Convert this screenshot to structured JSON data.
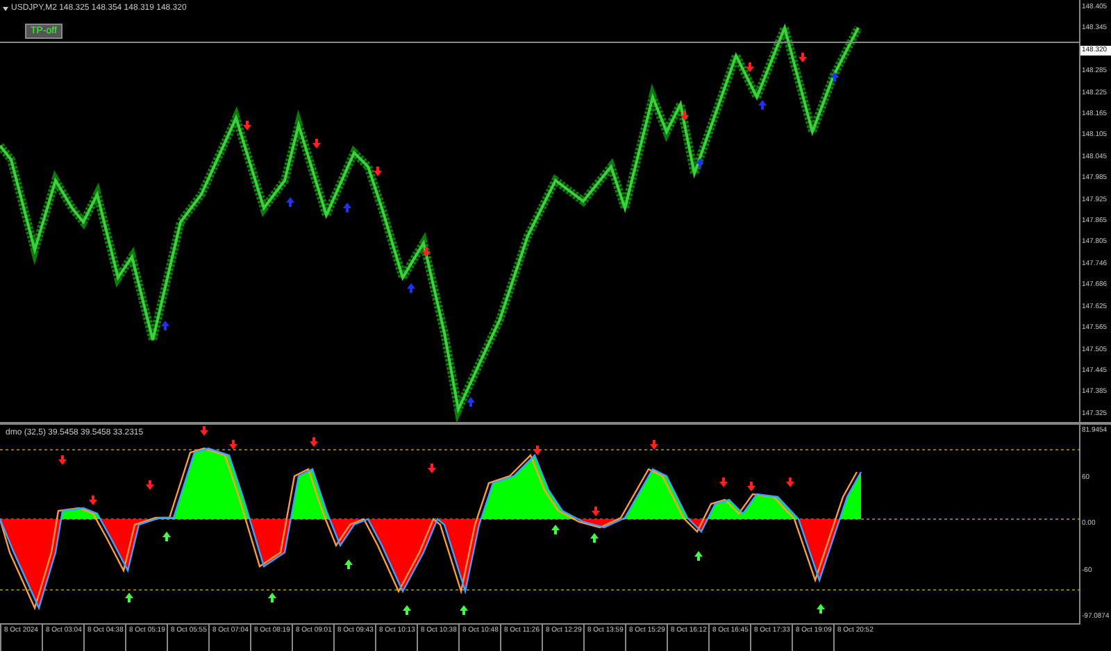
{
  "main_chart": {
    "title": "USDJPY,M2  148.325 148.354 148.319 148.320",
    "tp_button": "TP-off",
    "price_axis": [
      {
        "label": "148.405",
        "kind": "tick"
      },
      {
        "label": "148.345",
        "kind": "tick"
      },
      {
        "label": "148.320",
        "kind": "current"
      },
      {
        "label": "148.285",
        "kind": "tick"
      },
      {
        "label": "148.225",
        "kind": "tick"
      },
      {
        "label": "148.165",
        "kind": "tick"
      },
      {
        "label": "148.105",
        "kind": "tick"
      },
      {
        "label": "148.045",
        "kind": "tick"
      },
      {
        "label": "147.985",
        "kind": "tick"
      },
      {
        "label": "147.925",
        "kind": "tick"
      },
      {
        "label": "147.865",
        "kind": "tick"
      },
      {
        "label": "147.805",
        "kind": "tick"
      },
      {
        "label": "147.746",
        "kind": "tick"
      },
      {
        "label": "147.686",
        "kind": "tick"
      },
      {
        "label": "147.625",
        "kind": "tick"
      },
      {
        "label": "147.565",
        "kind": "tick"
      },
      {
        "label": "147.505",
        "kind": "tick"
      },
      {
        "label": "147.445",
        "kind": "tick"
      },
      {
        "label": "147.385",
        "kind": "tick"
      },
      {
        "label": "147.325",
        "kind": "tick"
      }
    ]
  },
  "indicator": {
    "title": "dmo (32,5) 39.5458 39.5458 33.2315",
    "axis": [
      "81.9454",
      "60",
      "0.00",
      "-60",
      "-97.0874"
    ]
  },
  "time_axis": [
    "8 Oct 2024",
    "8 Oct 03:04",
    "8 Oct 04:38",
    "8 Oct 05:19",
    "8 Oct 05:55",
    "8 Oct 07:04",
    "8 Oct 08:19",
    "8 Oct 09:01",
    "8 Oct 09:43",
    "8 Oct 10:13",
    "8 Oct 10:38",
    "8 Oct 10:48",
    "8 Oct 11:26",
    "8 Oct 12:29",
    "8 Oct 13:59",
    "8 Oct 15:29",
    "8 Oct 16:12",
    "8 Oct 16:45",
    "8 Oct 17:33",
    "8 Oct 19:09",
    "8 Oct 20:52"
  ]
}
